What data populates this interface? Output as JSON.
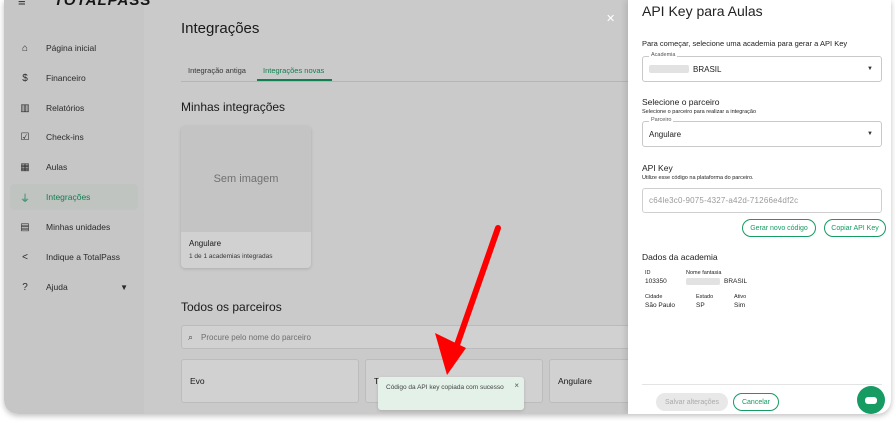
{
  "brand": {
    "logo": "TOTALPASS",
    "accent": "#169b62",
    "annotation_arrow": "#ff0000"
  },
  "sidebar": {
    "items": [
      {
        "label": "Página inicial",
        "icon": "home-icon"
      },
      {
        "label": "Financeiro",
        "icon": "dollar-icon"
      },
      {
        "label": "Relatórios",
        "icon": "chart-icon"
      },
      {
        "label": "Check-ins",
        "icon": "checklist-icon"
      },
      {
        "label": "Aulas",
        "icon": "calendar-icon"
      },
      {
        "label": "Integrações",
        "icon": "plug-icon"
      },
      {
        "label": "Minhas unidades",
        "icon": "store-icon"
      },
      {
        "label": "Indique a TotalPass",
        "icon": "share-icon"
      },
      {
        "label": "Ajuda",
        "icon": "help-icon"
      }
    ]
  },
  "main": {
    "title": "Integrações",
    "tabs": [
      {
        "label": "Integração antiga"
      },
      {
        "label": "Integrações novas"
      }
    ],
    "my_integrations_title": "Minhas integrações",
    "card": {
      "image_placeholder": "Sem imagem",
      "name": "Angulare",
      "subtitle": "1 de 1 academias integradas"
    },
    "all_partners_title": "Todos os parceiros",
    "search_placeholder": "Procure pelo nome do parceiro",
    "partners": [
      "Evo",
      "To",
      "Angulare"
    ]
  },
  "panel": {
    "title": "API Key para Aulas",
    "intro": "Para começar, selecione uma academia para gerar a API Key",
    "academy": {
      "label": "Academia",
      "value": "BRASIL"
    },
    "partner_section_title": "Selecione o parceiro",
    "partner_section_sub": "Selecione o parceiro para realizar a integração",
    "partner_select": {
      "label": "Parceiro",
      "value": "Angulare"
    },
    "apikey_title": "API Key",
    "apikey_sub": "Utilize esse código na plataforma do parceiro.",
    "apikey_value": "c64le3c0-9075-4327-a42d-71266e4df2c",
    "generate_button": "Gerar novo código",
    "copy_button": "Copiar API Key",
    "academy_data_title": "Dados da academia",
    "fields": {
      "id_label": "ID",
      "id_value": "103350",
      "fantasy_label": "Nome fantasia",
      "fantasy_value": "BRASIL",
      "city_label": "Cidade",
      "city_value": "São Paulo",
      "state_label": "Estado",
      "state_value": "SP",
      "active_label": "Ativo",
      "active_value": "Sim"
    },
    "save_button": "Salvar alterações",
    "cancel_button": "Cancelar"
  },
  "toast": {
    "message": "Código da API key copiada com sucesso"
  }
}
